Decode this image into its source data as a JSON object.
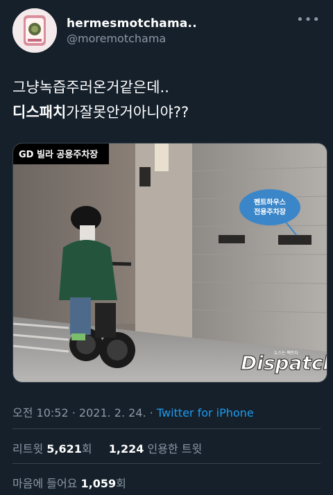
{
  "tweet": {
    "display_name": "hermesmotchama..",
    "handle": "@moremotchama",
    "text_line1": "그냥녹즙주러온거같은데..",
    "text_line2_bold": "디스패치",
    "text_line2_rest": "가잘못안거아니야??"
  },
  "media": {
    "location_label": "GD 빌라 공용주차장",
    "callout_line1": "펜트하우스",
    "callout_line2": "전용주차장",
    "watermark": "Dispatch",
    "watermark_tag": "뉴스는 팩트다"
  },
  "meta": {
    "time": "오전 10:52",
    "sep1": " · ",
    "date": "2021. 2. 24.",
    "sep2": " · ",
    "client": "Twitter for iPhone"
  },
  "stats": {
    "retweets_label": "리트윗",
    "retweets_count": "5,621",
    "retweets_unit": "회",
    "quotes_count": "1,224",
    "quotes_label": "인용한 트윗",
    "likes_label": "마음에 들어요",
    "likes_count": "1,059",
    "likes_unit": "회"
  },
  "icons": {
    "more": "more-dots-icon"
  },
  "colors": {
    "background": "#15202b",
    "link": "#1d9bf0",
    "muted": "#8b98a5",
    "divider": "#38444d"
  }
}
